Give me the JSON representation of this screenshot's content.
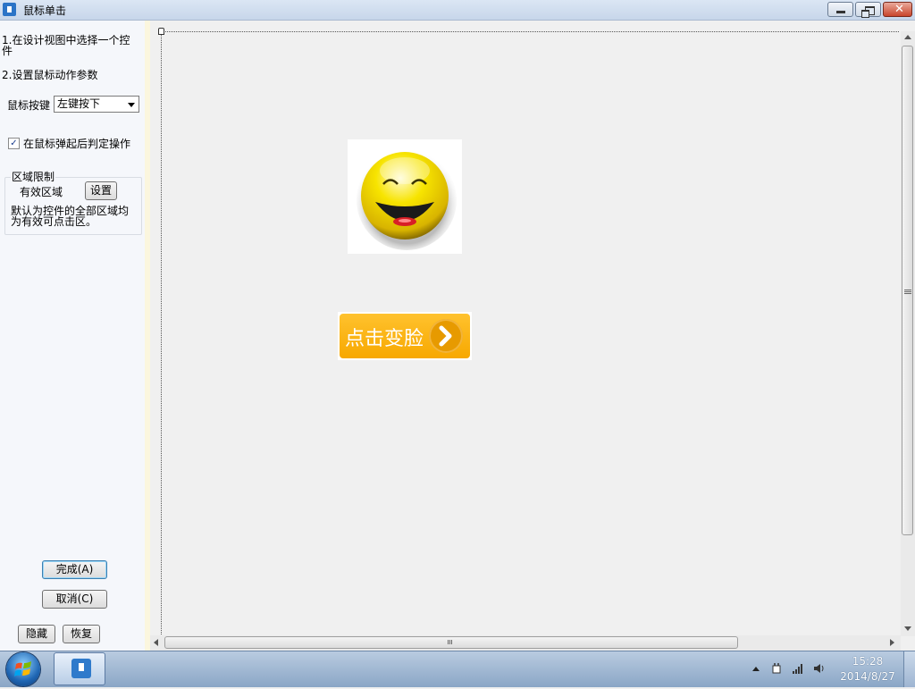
{
  "window": {
    "title": "鼠标单击",
    "controls": {
      "minimize": "minimize",
      "maximize": "restore",
      "close": "✕"
    }
  },
  "panel": {
    "step1": "1.在设计视图中选择一个控件",
    "step2": "2.设置鼠标动作参数",
    "mouse_button_label": "鼠标按键",
    "mouse_button_value": "左键按下",
    "release_checkbox_label": "在鼠标弹起后判定操作",
    "release_checkbox_checked": true,
    "region_group_title": "区域限制",
    "valid_area_label": "有效区域",
    "set_button": "设置",
    "region_description": "默认为控件的全部区域均为有效可点击区。",
    "finish_button": "完成(A)",
    "cancel_button": "取消(C)",
    "hide_button": "隐藏",
    "restore_button": "恢复"
  },
  "canvas": {
    "smiley_image": "smiley-face-icon",
    "change_face_button": "点击变脸",
    "change_face_arrow": "›"
  },
  "taskbar": {
    "time": "15:28",
    "date": "2014/8/27"
  },
  "colors": {
    "accent_button": "#f7a800",
    "smiley": "#f5d800"
  }
}
